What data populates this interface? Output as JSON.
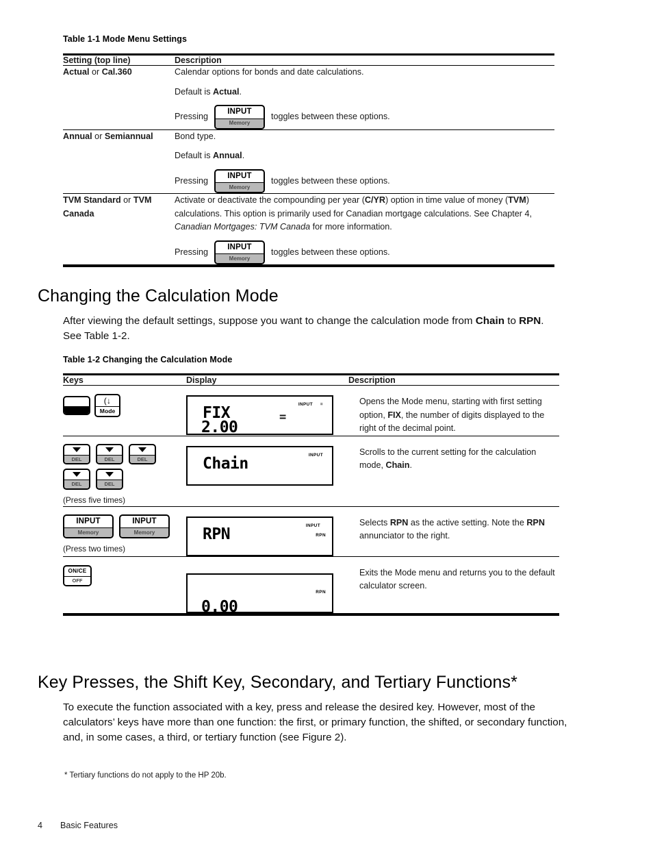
{
  "table1": {
    "caption": "Table 1-1  Mode Menu Settings",
    "columns": [
      "Setting (top line)",
      "Description"
    ],
    "rows": [
      {
        "setting_bold1": "Actual",
        "setting_conj": " or ",
        "setting_bold2": "Cal.360",
        "desc_line1": "Calendar options for bonds and date calculations.",
        "desc_line2_pre": "Default is ",
        "desc_line2_bold": "Actual",
        "desc_line2_post": ".",
        "press_pre": "Pressing",
        "key_top": "INPUT",
        "key_bottom": "Memory",
        "press_post": "toggles between these options."
      },
      {
        "setting_bold1": "Annual",
        "setting_conj": " or ",
        "setting_bold2": "Semiannual",
        "desc_line1": "Bond type.",
        "desc_line2_pre": "Default is ",
        "desc_line2_bold": "Annual",
        "desc_line2_post": ".",
        "press_pre": "Pressing",
        "key_top": "INPUT",
        "key_bottom": "Memory",
        "press_post": "toggles between these options."
      },
      {
        "setting_bold1": "TVM Standard",
        "setting_conj": " or ",
        "setting_bold2": "TVM Canada",
        "desc_part1": "Activate or deactivate the compounding per year (",
        "desc_b1": "C/YR",
        "desc_part2": ") option in time value of money (",
        "desc_b2": "TVM",
        "desc_part3": ") calculations. This option is primarily used for Canadian mortgage calculations. See Chapter 4, ",
        "desc_italic": "Canadian Mortgages: TVM Canada",
        "desc_part4": " for more information.",
        "press_pre": "Pressing",
        "key_top": "INPUT",
        "key_bottom": "Memory",
        "press_post": "toggles between these options."
      }
    ]
  },
  "section1": {
    "heading": "Changing the Calculation Mode",
    "para_pre": "After viewing the default settings, suppose you want to change the calculation mode from ",
    "para_b1": "Chain",
    "para_mid": " to ",
    "para_b2": "RPN",
    "para_post": ". See Table 1-2."
  },
  "table2": {
    "caption": "Table 1-2  Changing the Calculation Mode",
    "columns": [
      "Keys",
      "Display",
      "Description"
    ],
    "rows": [
      {
        "keys": [
          {
            "type": "shift",
            "top": "",
            "bottom": ""
          },
          {
            "type": "mode",
            "top": "(↓",
            "bottom": "Mode"
          }
        ],
        "press_note": "",
        "display": {
          "line1": "FIX",
          "line2": "2.00",
          "big_eq": "=",
          "annunciators": [
            "INPUT",
            "="
          ]
        },
        "desc_p1": "Opens the Mode menu, starting with first setting option, ",
        "desc_b1": "FIX",
        "desc_p2": ", the number of digits displayed to the right of the decimal point."
      },
      {
        "keys": [
          {
            "type": "del",
            "top": "▼",
            "bottom": "DEL"
          },
          {
            "type": "del",
            "top": "▼",
            "bottom": "DEL"
          },
          {
            "type": "del",
            "top": "▼",
            "bottom": "DEL"
          },
          {
            "type": "del",
            "top": "▼",
            "bottom": "DEL"
          },
          {
            "type": "del",
            "top": "▼",
            "bottom": "DEL"
          }
        ],
        "press_note": "(Press five times)",
        "display": {
          "line1": "Chain",
          "line2": "",
          "big_eq": "",
          "annunciators": [
            "INPUT"
          ]
        },
        "desc_p1": "Scrolls to the current setting for the calculation mode, ",
        "desc_b1": "Chain",
        "desc_p2": "."
      },
      {
        "keys": [
          {
            "type": "input",
            "top": "INPUT",
            "bottom": "Memory"
          },
          {
            "type": "input",
            "top": "INPUT",
            "bottom": "Memory"
          }
        ],
        "press_note": "(Press two times)",
        "display": {
          "line1": "RPN",
          "line2": "",
          "big_eq": "",
          "annunciators": [
            "INPUT",
            "RPN"
          ]
        },
        "desc_p1": "Selects ",
        "desc_b1": "RPN",
        "desc_p2": " as the active setting. Note the ",
        "desc_b2": "RPN",
        "desc_p3": " annunciator to the right."
      },
      {
        "keys": [
          {
            "type": "once",
            "top": "ON/CE",
            "bottom": "OFF"
          }
        ],
        "press_note": "",
        "display": {
          "line1": "",
          "line2": "0.00",
          "big_eq": "",
          "annunciators": [
            "RPN"
          ]
        },
        "desc_p1": "Exits the Mode menu and returns you to the default calculator screen.",
        "desc_b1": "",
        "desc_p2": ""
      }
    ]
  },
  "section2": {
    "heading": "Key Presses, the Shift Key, Secondary, and Tertiary Functions*",
    "paragraph": "To execute the function associated with a key, press and release the desired key. However, most of the calculators’ keys have more than one function: the first, or primary function, the shifted, or secondary function, and, in some cases, a third, or tertiary function (see Figure 2)."
  },
  "footnote": "* Tertiary functions do not apply to the HP 20b.",
  "footer": {
    "page_number": "4",
    "section_name": "Basic Features"
  }
}
